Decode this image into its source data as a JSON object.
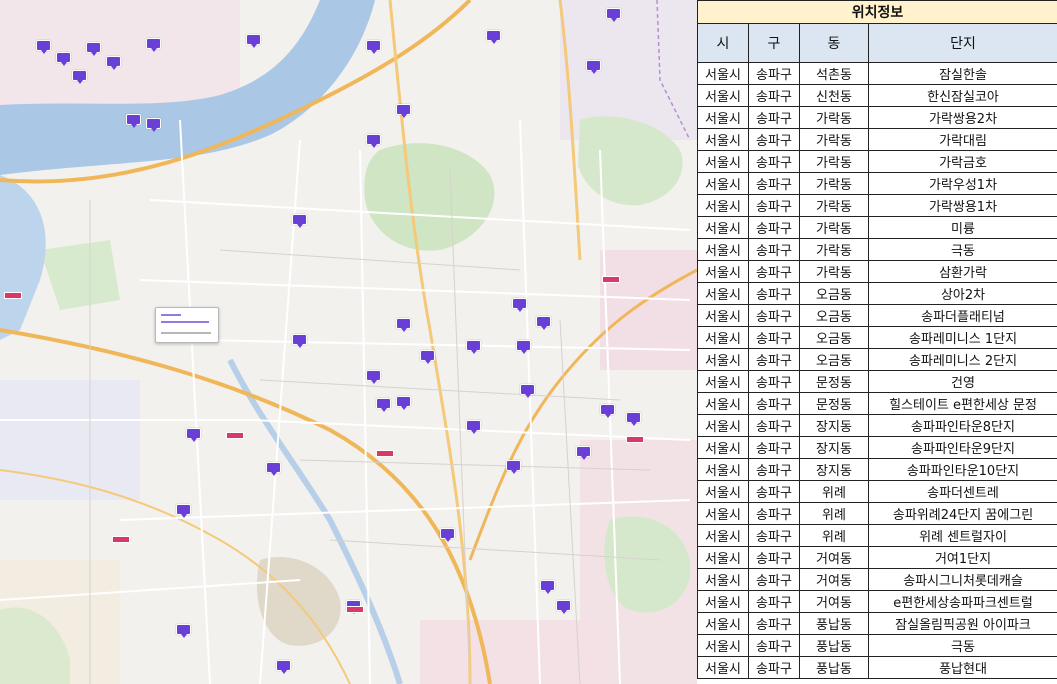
{
  "table": {
    "title": "위치정보",
    "columns": [
      "시",
      "구",
      "동",
      "단지"
    ],
    "rows": [
      [
        "서울시",
        "송파구",
        "석촌동",
        "잠실한솔"
      ],
      [
        "서울시",
        "송파구",
        "신천동",
        "한신잠실코아"
      ],
      [
        "서울시",
        "송파구",
        "가락동",
        "가락쌍용2차"
      ],
      [
        "서울시",
        "송파구",
        "가락동",
        "가락대림"
      ],
      [
        "서울시",
        "송파구",
        "가락동",
        "가락금호"
      ],
      [
        "서울시",
        "송파구",
        "가락동",
        "가락우성1차"
      ],
      [
        "서울시",
        "송파구",
        "가락동",
        "가락쌍용1차"
      ],
      [
        "서울시",
        "송파구",
        "가락동",
        "미륭"
      ],
      [
        "서울시",
        "송파구",
        "가락동",
        "극동"
      ],
      [
        "서울시",
        "송파구",
        "가락동",
        "삼환가락"
      ],
      [
        "서울시",
        "송파구",
        "오금동",
        "상아2차"
      ],
      [
        "서울시",
        "송파구",
        "오금동",
        "송파더플래티넘"
      ],
      [
        "서울시",
        "송파구",
        "오금동",
        "송파레미니스 1단지"
      ],
      [
        "서울시",
        "송파구",
        "오금동",
        "송파레미니스 2단지"
      ],
      [
        "서울시",
        "송파구",
        "문정동",
        "건영"
      ],
      [
        "서울시",
        "송파구",
        "문정동",
        "힐스테이트 e편한세상 문정"
      ],
      [
        "서울시",
        "송파구",
        "장지동",
        "송파파인타운8단지"
      ],
      [
        "서울시",
        "송파구",
        "장지동",
        "송파파인타운9단지"
      ],
      [
        "서울시",
        "송파구",
        "장지동",
        "송파파인타운10단지"
      ],
      [
        "서울시",
        "송파구",
        "위례",
        "송파더센트레"
      ],
      [
        "서울시",
        "송파구",
        "위례",
        "송파위례24단지 꿈에그린"
      ],
      [
        "서울시",
        "송파구",
        "위례",
        "위례 센트럴자이"
      ],
      [
        "서울시",
        "송파구",
        "거여동",
        "거여1단지"
      ],
      [
        "서울시",
        "송파구",
        "거여동",
        "송파시그니처롯데캐슬"
      ],
      [
        "서울시",
        "송파구",
        "거여동",
        "e편한세상송파파크센트럴"
      ],
      [
        "서울시",
        "송파구",
        "풍납동",
        "잠실올림픽공원 아이파크"
      ],
      [
        "서울시",
        "송파구",
        "풍납동",
        "극동"
      ],
      [
        "서울시",
        "송파구",
        "풍납동",
        "풍납현대"
      ]
    ]
  },
  "map": {
    "marker_color": "#6a3fd6",
    "river_color": "#aac8e6",
    "park_color": "#cfe5c3",
    "highway_color": "#f0b75a"
  }
}
